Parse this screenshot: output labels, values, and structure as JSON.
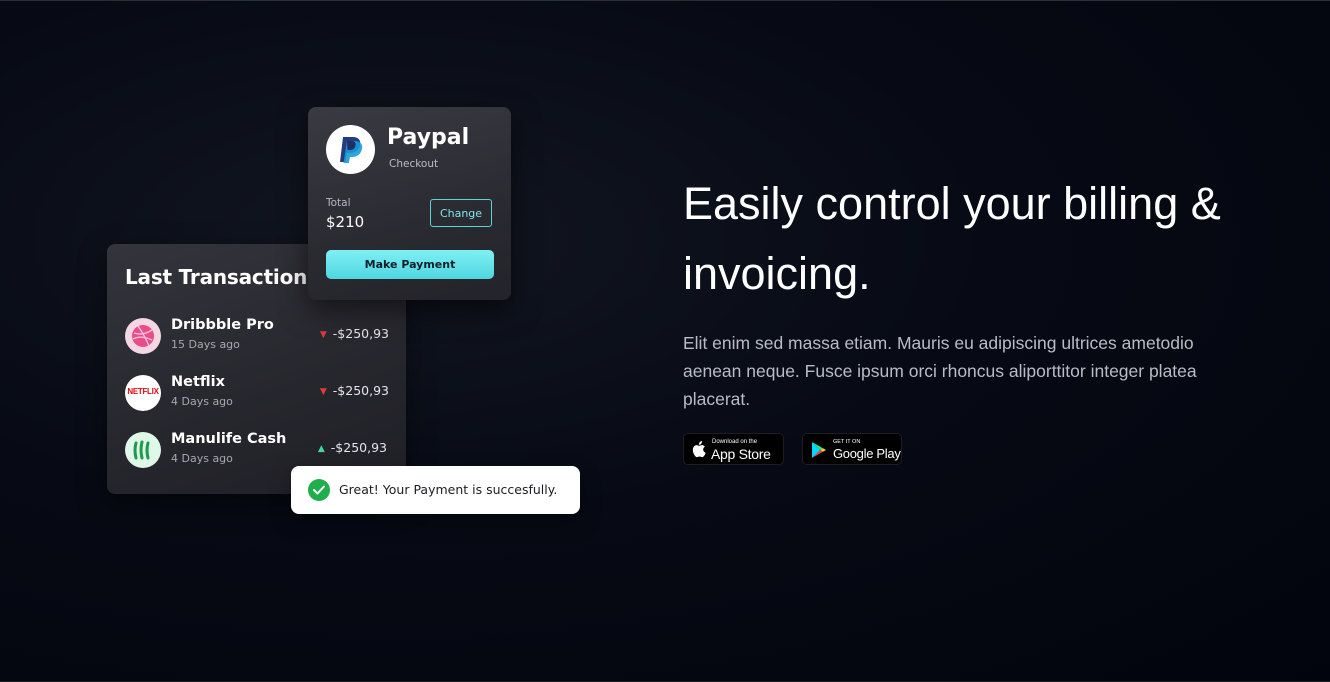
{
  "transactions_card": {
    "title": "Last Transaction",
    "items": [
      {
        "name": "Dribbble Pro",
        "date": "15 Days ago",
        "amount": "-$250,93",
        "direction": "down",
        "logo": "dribbble-icon"
      },
      {
        "name": "Netflix",
        "date": "4 Days ago",
        "amount": "-$250,93",
        "direction": "down",
        "logo": "netflix-icon",
        "logo_text": "NETFLIX"
      },
      {
        "name": "Manulife Cash",
        "date": "4 Days ago",
        "amount": "-$250,93",
        "direction": "up",
        "logo": "manulife-icon"
      }
    ]
  },
  "paypal_card": {
    "name": "Paypal",
    "subtitle": "Checkout",
    "total_label": "Total",
    "total_value": "$210",
    "change_label": "Change",
    "pay_label": "Make Payment"
  },
  "toast": {
    "message": "Great! Your Payment is succesfully."
  },
  "hero": {
    "title": "Easily control your billing & invoicing.",
    "body": "Elit enim sed massa etiam. Mauris eu adipiscing ultrices ametodio aenean neque. Fusce ipsum orci rhoncus aliporttitor integer platea placerat."
  },
  "stores": {
    "apple": {
      "small": "Download on the",
      "big": "App Store"
    },
    "google": {
      "small": "GET IT ON",
      "big": "Google Play"
    }
  },
  "colors": {
    "accent_cyan": "#5fd3da",
    "down_red": "#e03a3a",
    "up_green": "#3fd8a0",
    "success_green": "#1fae4b",
    "dribbble_pink": "#ea4c89",
    "netflix_red": "#e50914"
  }
}
